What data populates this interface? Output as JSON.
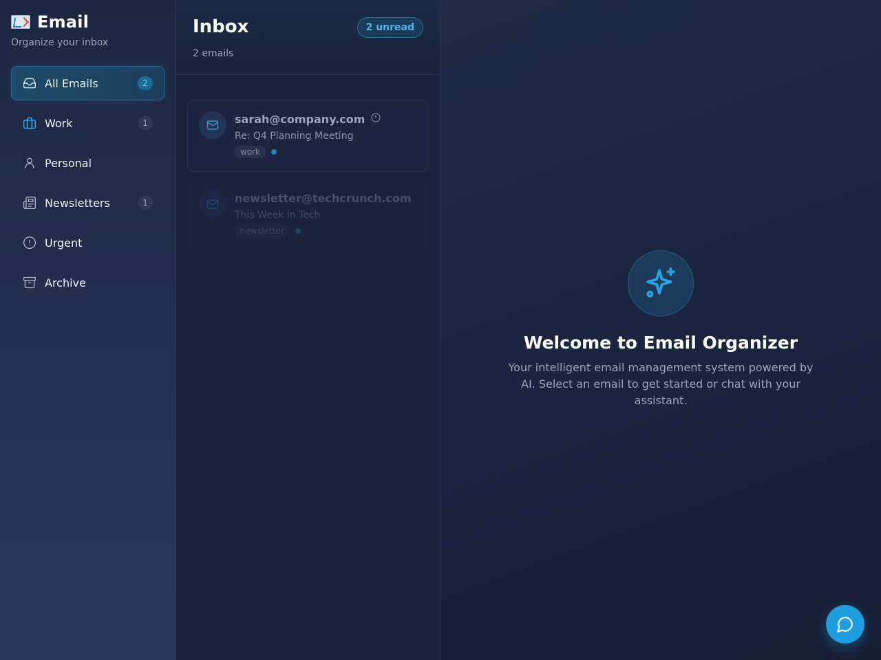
{
  "sidebar": {
    "title": "Email",
    "subtitle": "Organize your inbox",
    "items": [
      {
        "label": "All Emails",
        "badge": "2",
        "icon": "inbox-icon"
      },
      {
        "label": "Work",
        "badge": "1",
        "icon": "briefcase-icon"
      },
      {
        "label": "Personal",
        "badge": "",
        "icon": "user-icon"
      },
      {
        "label": "Newsletters",
        "badge": "1",
        "icon": "newspaper-icon"
      },
      {
        "label": "Urgent",
        "badge": "",
        "icon": "alert-circle-icon"
      },
      {
        "label": "Archive",
        "badge": "",
        "icon": "archive-icon"
      }
    ]
  },
  "list": {
    "title": "Inbox",
    "count": "2 emails",
    "unread": "2 unread",
    "emails": [
      {
        "from": "sarah@company.com",
        "subject": "Re: Q4 Planning Meeting",
        "tag": "work"
      },
      {
        "from": "newsletter@techcrunch.com",
        "subject": "This Week in Tech",
        "tag": "newsletter"
      }
    ]
  },
  "main": {
    "welcome_title": "Welcome to Email Organizer",
    "welcome_text": "Your intelligent email management system powered by AI. Select an email to get started or chat with your assistant."
  },
  "colors": {
    "accent": "#1e9ee0",
    "background": "#17203a",
    "sidebar": "#1b2740"
  }
}
